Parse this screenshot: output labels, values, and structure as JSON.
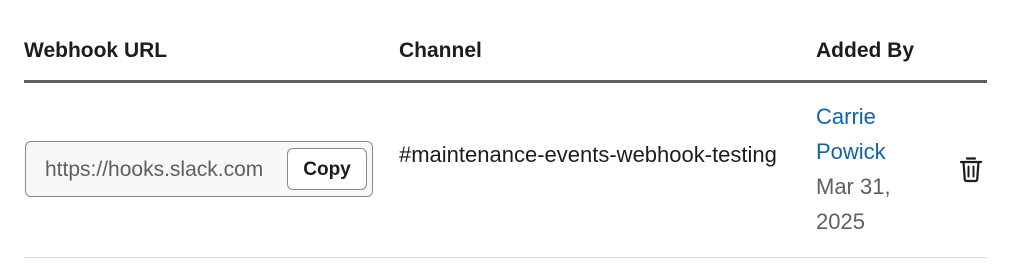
{
  "table": {
    "headers": {
      "webhook_url": "Webhook URL",
      "channel": "Channel",
      "added_by": "Added By"
    },
    "rows": [
      {
        "webhook_url": "https://hooks.slack.com",
        "copy_label": "Copy",
        "channel": "#maintenance-events-webhook-testing",
        "added_by_user": "Carrie Powick",
        "added_date": "Mar 31, 2025",
        "delete_icon": "trash-icon"
      }
    ]
  },
  "colors": {
    "link": "#1264a3",
    "header_rule": "#5e5d60",
    "muted_text": "#616061"
  }
}
